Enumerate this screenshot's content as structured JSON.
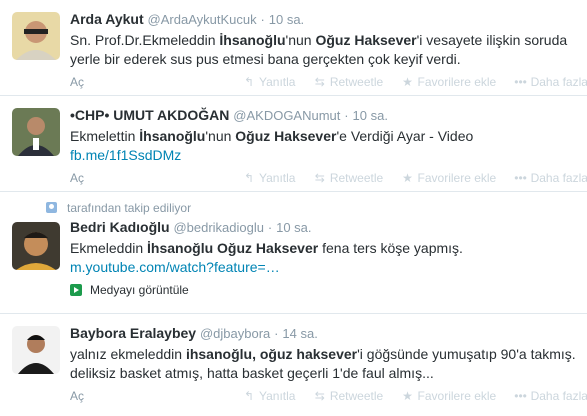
{
  "actions": {
    "reply": "Yanıtla",
    "retweet": "Retweetle",
    "favorite": "Favorilere ekle",
    "more": "Daha fazla",
    "reply_icon": "reply-icon",
    "retweet_icon": "retweet-icon",
    "favorite_icon": "star-icon",
    "more_icon": "ellipsis-icon"
  },
  "tweets": [
    {
      "fullname": "Arda Aykut",
      "username": "@ArdaAykutKucuk",
      "dot": "·",
      "time": "10 sa.",
      "text": [
        {
          "t": "Sn. Prof.Dr.Ekmeleddin ",
          "b": false
        },
        {
          "t": "İhsanoğlu",
          "b": true
        },
        {
          "t": "'nun ",
          "b": false
        },
        {
          "t": "Oğuz Haksever",
          "b": true
        },
        {
          "t": "'i vesayete ilişkin soruda yerle bir ederek sus pus etmesi bana gerçekten çok keyif verdi.",
          "b": false
        }
      ],
      "expand": "Aç"
    },
    {
      "fullname": "•CHP• UMUT AKDOĞAN",
      "username": "@AKDOGANumut",
      "dot": "·",
      "time": "10 sa.",
      "text": [
        {
          "t": "Ekmelettin ",
          "b": false
        },
        {
          "t": "İhsanoğlu",
          "b": true
        },
        {
          "t": "'nun ",
          "b": false
        },
        {
          "t": "Oğuz Haksever",
          "b": true
        },
        {
          "t": "'e Verdiği Ayar - Video",
          "b": false
        }
      ],
      "link": "fb.me/1f1SsdDMz",
      "expand": "Aç"
    },
    {
      "context": "tarafından takip ediliyor",
      "fullname": "Bedri Kadıoğlu",
      "username": "@bedrikadioglu",
      "dot": "·",
      "time": "10 sa.",
      "text": [
        {
          "t": "Ekmeleddin ",
          "b": false
        },
        {
          "t": "İhsanoğlu Oğuz Haksever",
          "b": true
        },
        {
          "t": " fena ters köşe yapmış.",
          "b": false
        }
      ],
      "link": "m.youtube.com/watch?feature=…",
      "media": "Medyayı görüntüle"
    },
    {
      "fullname": "Baybora Eralaybey",
      "username": "@djbaybora",
      "dot": "·",
      "time": "14 sa.",
      "text": [
        {
          "t": "yalnız ekmeleddin ",
          "b": false
        },
        {
          "t": "ihsanoğlu, oğuz haksever",
          "b": true
        },
        {
          "t": "'i göğsünde yumuşatıp 90'a takmış. deliksiz basket atmış, hatta basket geçerli 1'de faul almış...",
          "b": false
        }
      ],
      "expand": "Aç"
    }
  ]
}
